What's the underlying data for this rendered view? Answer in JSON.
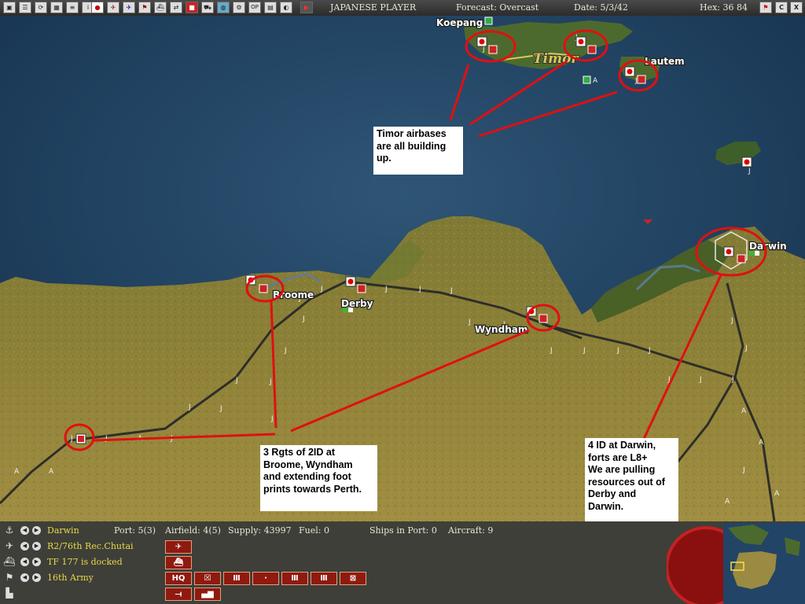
{
  "topbar": {
    "player": "JAPANESE PLAYER",
    "forecast": "Forecast: Overcast",
    "date": "Date: 5/3/42",
    "hex": "Hex: 36 84",
    "buttons_right": [
      "flag",
      "C",
      "X"
    ]
  },
  "map": {
    "places": {
      "koepang": "Koepang",
      "timor": "Timor",
      "lautem": "Lautem",
      "broome": "Broome",
      "derby": "Derby",
      "wyndham": "Wyndham",
      "darwin": "Darwin"
    },
    "annotations": {
      "timor": "Timor airbases\nare all building\nup.",
      "rgts": "3 Rgts of 2ID at\nBroome, Wyndham\nand extending foot\nprints towards Perth.",
      "darwin": "4 ID at Darwin,\nforts are L8+\nWe are pulling\nresources out of\nDerby and\nDarwin."
    }
  },
  "bottom": {
    "rows": [
      {
        "label": "Darwin",
        "icon": "anchor-icon"
      },
      {
        "label": "R2/76th Rec.Chutai",
        "icon": "plane-icon"
      },
      {
        "label": "TF 177 is docked",
        "icon": "ship-icon"
      },
      {
        "label": "16th Army",
        "icon": "flag-icon"
      }
    ],
    "stats": {
      "port": "Port: 5(3)",
      "airfield": "Airfield: 4(5)",
      "supply": "Supply: 43997",
      "fuel": "Fuel: 0",
      "ships": "Ships in Port: 0",
      "aircraft": "Aircraft: 9"
    },
    "unit_buttons": {
      "hq": "HQ"
    }
  }
}
